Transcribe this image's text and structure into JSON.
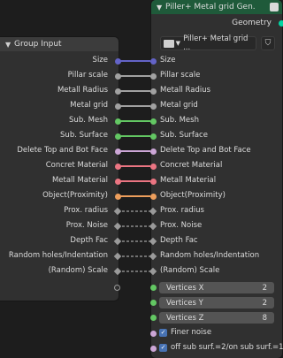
{
  "group_input": {
    "title": "Group Input"
  },
  "gen_node": {
    "title": "Piller+ Metal grid Gen.",
    "output_label": "Geometry",
    "node_group": "Piller+ Metal grid ..."
  },
  "sockets": [
    {
      "label": "Size",
      "color": "#6363c7",
      "kind": "circle"
    },
    {
      "label": "Pillar scale",
      "color": "#a1a1a1",
      "kind": "circle"
    },
    {
      "label": "Metall Radius",
      "color": "#a1a1a1",
      "kind": "circle"
    },
    {
      "label": "Metal grid",
      "color": "#a1a1a1",
      "kind": "circle"
    },
    {
      "label": "Sub. Mesh",
      "color": "#63c763",
      "kind": "circle"
    },
    {
      "label": "Sub. Surface",
      "color": "#63c763",
      "kind": "circle"
    },
    {
      "label": "Delete Top and Bot Face",
      "color": "#cca6d6",
      "kind": "circle"
    },
    {
      "label": "Concret Material",
      "color": "#eb7582",
      "kind": "circle"
    },
    {
      "label": "Metall Material",
      "color": "#eb7582",
      "kind": "circle"
    },
    {
      "label": "Object(Proximity)",
      "color": "#ed9e5c",
      "kind": "circle"
    },
    {
      "label": "Prox. radius",
      "color": "#a1a1a1",
      "kind": "diamond"
    },
    {
      "label": "Prox. Noise",
      "color": "#a1a1a1",
      "kind": "diamond"
    },
    {
      "label": "Depth Fac",
      "color": "#a1a1a1",
      "kind": "diamond"
    },
    {
      "label": "Random holes/Indentation",
      "color": "#a1a1a1",
      "kind": "diamond"
    },
    {
      "label": "(Random) Scale",
      "color": "#a1a1a1",
      "kind": "diamond"
    }
  ],
  "vertices": [
    {
      "label": "Vertices X",
      "value": "2"
    },
    {
      "label": "Vertices Y",
      "value": "2"
    },
    {
      "label": "Vertices Z",
      "value": "8"
    }
  ],
  "checkboxes": [
    {
      "label": "Finer noise",
      "checked": true
    },
    {
      "label": "off sub surf.=2/on sub surf.=1",
      "checked": true
    }
  ]
}
